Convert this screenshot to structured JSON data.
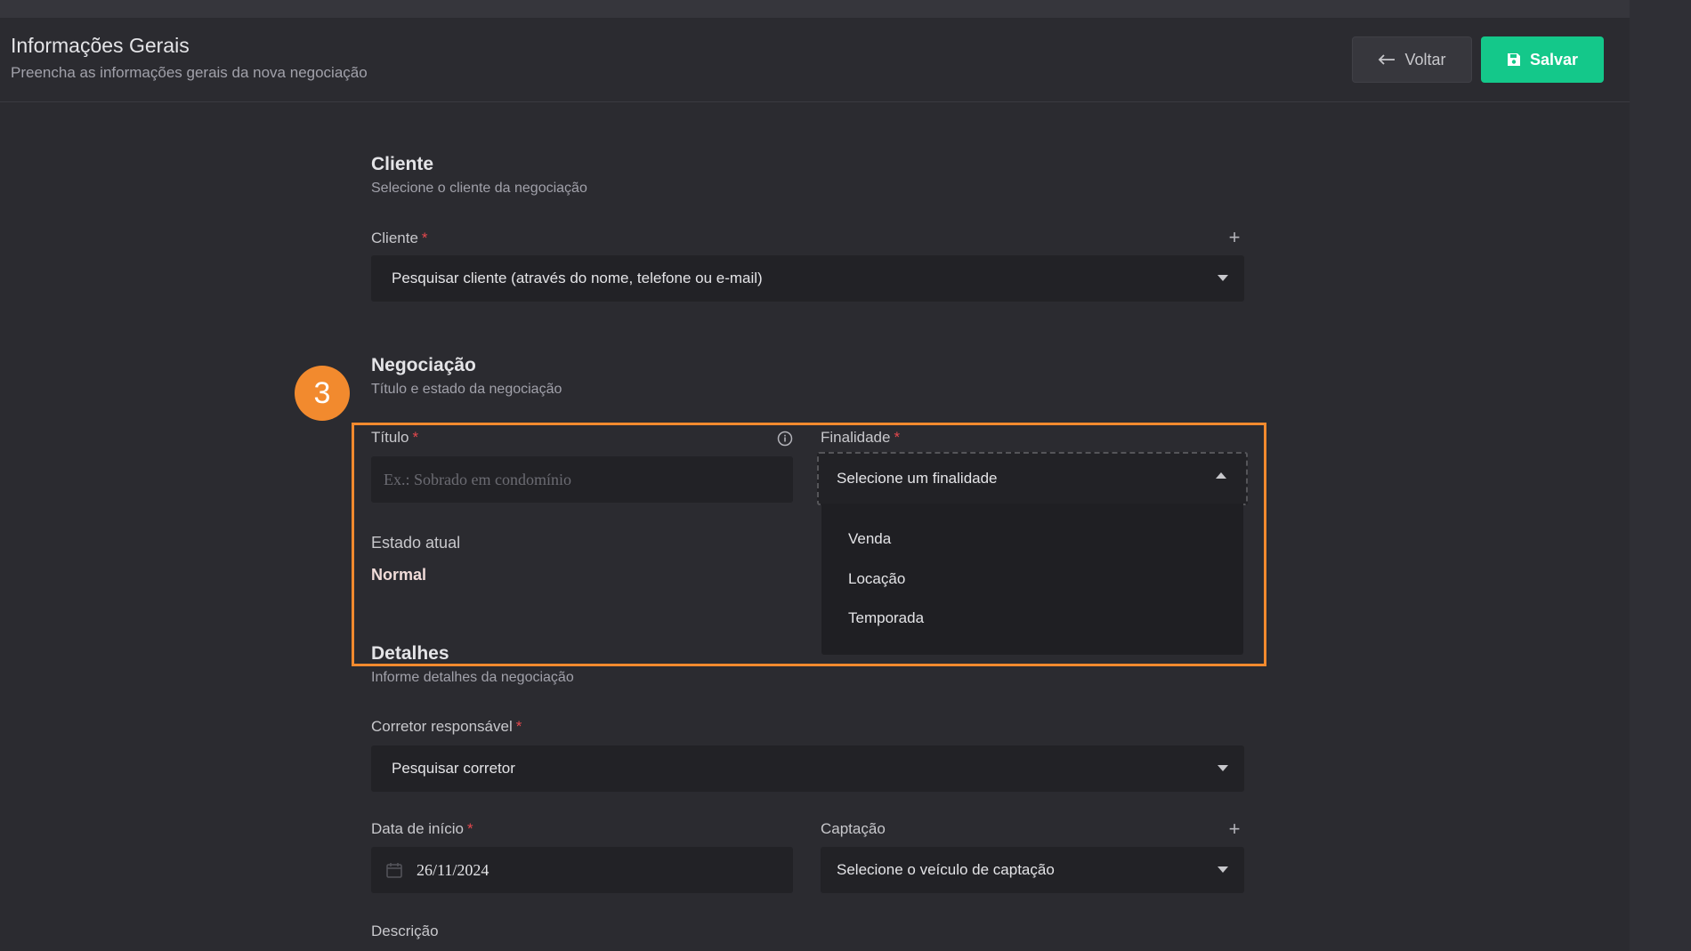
{
  "header": {
    "title": "Informações Gerais",
    "subtitle": "Preencha as informações gerais da nova negociação",
    "back_label": "Voltar",
    "save_label": "Salvar"
  },
  "cliente_section": {
    "title": "Cliente",
    "subtitle": "Selecione o cliente da negociação",
    "field_label": "Cliente",
    "required_mark": "*",
    "placeholder": "Pesquisar cliente (através do nome, telefone ou e-mail)"
  },
  "negociacao_section": {
    "title": "Negociação",
    "subtitle": "Título e estado da negociação",
    "titulo_label": "Título",
    "titulo_placeholder": "Ex.: Sobrado em condomínio",
    "finalidade_label": "Finalidade",
    "finalidade_placeholder": "Selecione um finalidade",
    "finalidade_options": [
      "Venda",
      "Locação",
      "Temporada"
    ],
    "estado_label": "Estado atual",
    "estado_value": "Normal"
  },
  "detalhes_section": {
    "title": "Detalhes",
    "subtitle": "Informe detalhes da negociação",
    "corretor_label": "Corretor responsável",
    "corretor_placeholder": "Pesquisar corretor",
    "data_label": "Data de início",
    "data_value": "26/11/2024",
    "captacao_label": "Captação",
    "captacao_placeholder": "Selecione o veículo de captação",
    "descricao_label": "Descrição"
  },
  "annotation": {
    "step_number": "3",
    "color": "#f28a2e"
  },
  "colors": {
    "accent_green": "#14c88a",
    "required_red": "#e5484d",
    "background": "#2b2b30"
  },
  "icons": [
    "arrow-left-icon",
    "save-icon",
    "plus-icon",
    "info-icon",
    "calendar-icon",
    "chevron-down-icon",
    "chevron-up-icon"
  ]
}
